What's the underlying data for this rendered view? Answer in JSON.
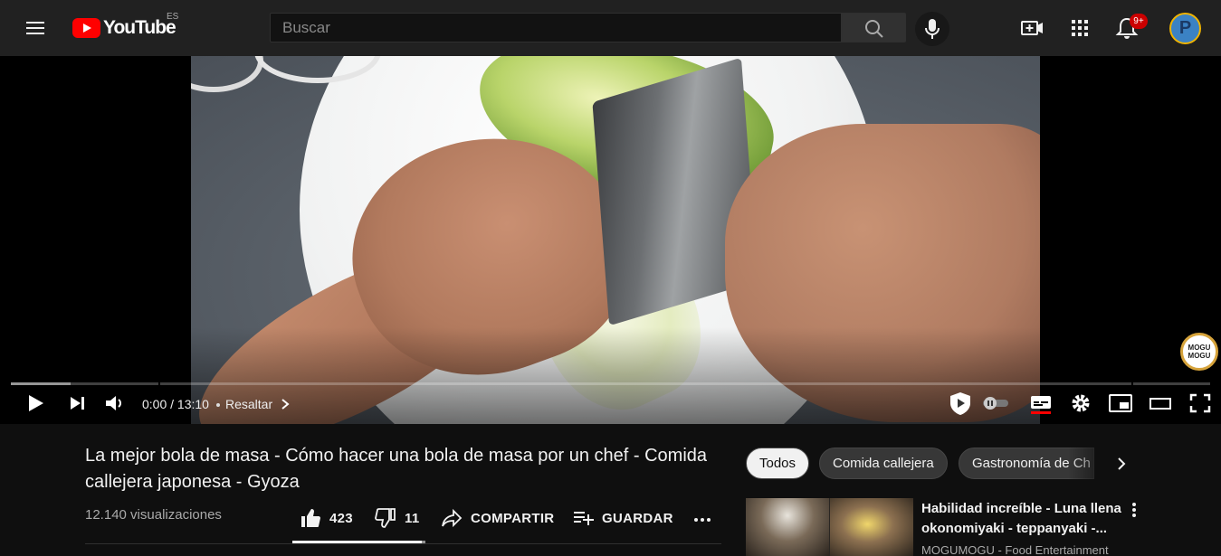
{
  "header": {
    "logo_text": "YouTube",
    "country_code": "ES",
    "search_placeholder": "Buscar",
    "notifications_badge": "9+",
    "avatar_letter": "P"
  },
  "player": {
    "time_display": "0:00 / 13:10",
    "chapter_label": "Resaltar",
    "watermark_text": "MOGU MOGU",
    "progress_loaded_fraction": 0.05,
    "autoplay_on": false
  },
  "video": {
    "title_line1": "La mejor bola de masa - Cómo hacer una bola de masa por un chef - Comida",
    "title_line2": "callejera japonesa - Gyoza",
    "views": "12.140 visualizaciones",
    "likes": "423",
    "dislikes": "11",
    "share_label": "COMPARTIR",
    "save_label": "GUARDAR",
    "like_ratio": 0.975
  },
  "chips": [
    "Todos",
    "Comida callejera",
    "Gastronomía de Ch"
  ],
  "recommendation": {
    "title_line1": "Habilidad increíble - Luna llena",
    "title_line2": "okonomiyaki - teppanyaki -...",
    "channel": "MOGUMOGU - Food Entertainment"
  },
  "colors": {
    "background": "#0f0f0f",
    "topbar": "#212121",
    "brand_red": "#ff0000",
    "badge_red": "#cc0000",
    "chip_active": "#f1f1f1",
    "chip_inactive": "#373737"
  },
  "icons": {
    "menu": "hamburger-icon",
    "search": "search-icon",
    "mic": "microphone-icon",
    "create": "video-camera-plus-icon",
    "apps": "grid-apps-icon",
    "notifications": "bell-icon",
    "play": "play-icon",
    "next": "next-track-icon",
    "volume": "volume-icon",
    "chapter": "chevron-right-icon",
    "autoplay": "autoplay-toggle-icon",
    "subtitles": "subtitles-icon",
    "settings": "gear-icon",
    "miniplayer": "miniplayer-icon",
    "theater": "theater-mode-icon",
    "fullscreen": "fullscreen-icon",
    "like": "thumbs-up-icon",
    "dislike": "thumbs-down-icon",
    "share": "share-arrow-icon",
    "save": "playlist-add-icon",
    "more": "more-horizontal-icon"
  }
}
